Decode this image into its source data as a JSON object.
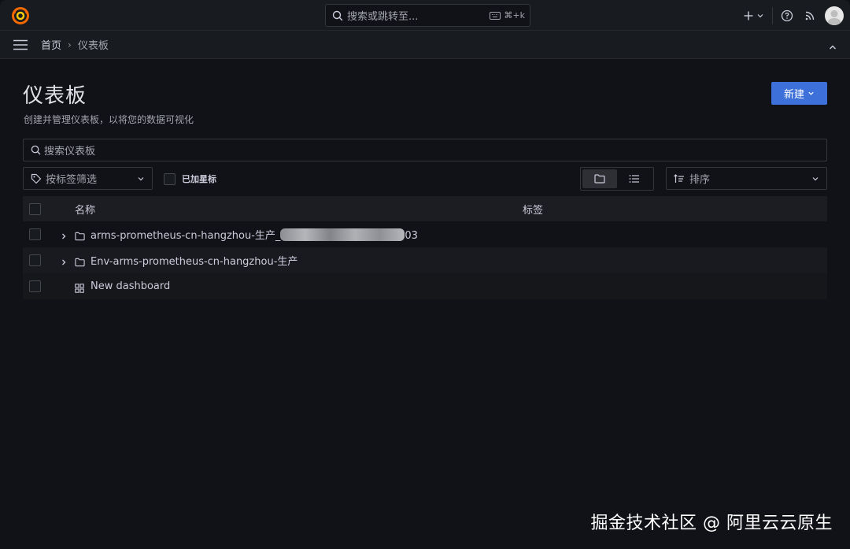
{
  "topbar": {
    "search_placeholder": "搜索或跳转至...",
    "search_shortcut": "⌘+k"
  },
  "breadcrumb": {
    "home": "首页",
    "current": "仪表板"
  },
  "header": {
    "title": "仪表板",
    "subtitle": "创建并管理仪表板，以将您的数据可视化",
    "new_button": "新建"
  },
  "filters": {
    "search_placeholder": "搜索仪表板",
    "tag_filter_placeholder": "按标签筛选",
    "starred_label": "已加星标",
    "sort_placeholder": "排序"
  },
  "table": {
    "columns": [
      "名称",
      "标签"
    ],
    "rows": [
      {
        "type": "folder",
        "name": "arms-prometheus-cn-hangzhou-生产_",
        "name_suffix": "03"
      },
      {
        "type": "folder",
        "name": "Env-arms-prometheus-cn-hangzhou-生产"
      },
      {
        "type": "dashboard",
        "name": "New dashboard"
      }
    ]
  },
  "watermark": "掘金技术社区 @ 阿里云云原生",
  "colors": {
    "background": "#111217",
    "panel": "#181b1f",
    "primary": "#3d71d9",
    "logo": "#f46800"
  }
}
